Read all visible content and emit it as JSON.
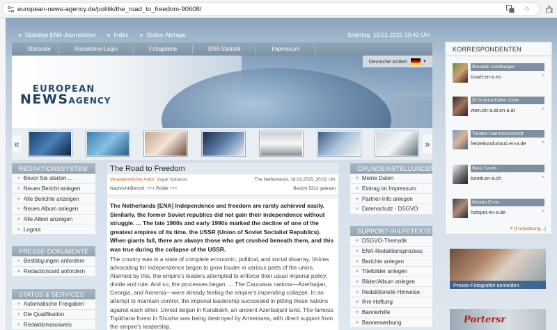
{
  "browser": {
    "url": "european-news-agency.de/politik/the_road_to_freedom-90608/"
  },
  "topbar": {
    "links": [
      "Ständige ENA-Journalisten",
      "Index",
      "Status-Abfrage"
    ],
    "date": "Sonntag, 19.01.2025 10:42 Uhr"
  },
  "mainnav": {
    "items": [
      "Startseite",
      "Redaktions-Login",
      "Fotogalerie",
      "ENA Statistik",
      "Impressum"
    ]
  },
  "banner": {
    "logo_line1": "EUROPEAN",
    "logo_line2a": "NEWS",
    "logo_line2b": "AGENCY",
    "lang_label": "Deutsche Artikel:"
  },
  "redaktionssystem": {
    "title": "REDAKTIONSSYSTEM",
    "items": [
      "Bevor Sie starten ...",
      "Neuen Bericht anlegen",
      "Alle Berichte anzeigen",
      "Neues Album anlegen",
      "Alle Alben anzeigen",
      "Logout"
    ]
  },
  "presse": {
    "title": "PRESSE-DOKUMENTE",
    "items": [
      "Bestätigungen anfordern",
      "Redactioncard anfordern"
    ]
  },
  "status": {
    "title": "STATUS & SERVICES",
    "items": [
      "Automatische Freigaben",
      "Die Qualifikation",
      "Redaktionsausweis"
    ]
  },
  "article": {
    "title": "The Road to Freedom",
    "author_label": "Verantwortlicher Autor:",
    "author": "Vugar Abbasov",
    "location_date": "The Netherlands, 18.01.2025, 20:02 Uhr",
    "category": "Nachricht/Bericht: +++ Politik +++",
    "reads": "Bericht 531x gelesen",
    "lead": "The Netherlands [ENA] Independence and freedom are rarely achieved easily. Similarly, the former Soviet republics did not gain their independence without struggle. ... The late 1980s and early 1990s marked the decline of one of the greatest empires of its time, the USSR (Union of Soviet Socialist Republics). When giants fall, there are always those who get crushed beneath them, and this was true during the collapse of the USSR.",
    "body": "The country was in a state of complete economic, political, and social disarray. Voices advocating for independence began to grow louder in various parts of the union. Alarmed by this, the empire's leaders attempted to enforce their usual imperial policy: divide and rule. And so, the processes began. ... The Caucasus nations—Azerbaijan, Georgia, and Armenia—were already feeling the empire's impending collapse. In an attempt to maintain control, the imperial leadership succeeded in pitting these nations against each other. Unrest began in Karabakh, an ancient Azerbaijani land. The famous Topkhana forest in Shusha was being destroyed by Armenians, with direct support from the empire's leadership."
  },
  "grundeinstellungen": {
    "title": "GRUNDEINSTELLUNGEN",
    "items": [
      "Meine Daten",
      "Eintrag im Impressum",
      "Partner-Info anlegen",
      "Datenschutz - DSGVO"
    ]
  },
  "support": {
    "title": "SUPPORT-/HILFETEXTE",
    "items": [
      "DSGVO-Thematik",
      "ENA-Redaktionsprozess",
      "Berichte anlegen",
      "Titelbilder anlegen",
      "Bilder/Album anlegen",
      "Redaktionelle Hinweise",
      "Ihre Haftung",
      "Bannerhilfe",
      "Bannerwerbung"
    ]
  },
  "korrespondenten": {
    "title": "KORRESPONDENTEN",
    "entries": [
      {
        "name": "Ronaldo Goldberger",
        "site": "Israel.en-a.eu"
      },
      {
        "name": "Dr.Schura Euller Cook",
        "site": "wien.en-a.at.en-a.at"
      },
      {
        "name": "Torsten Hammerschmidt",
        "site": "freizeitundurlaub.en-a.de"
      },
      {
        "name": "Reto Turotti",
        "site": "turotti.en-a.ch"
      },
      {
        "name": "Kirsten Ernst",
        "site": "hotspot.en-a.de"
      }
    ],
    "more": "[Fortsetzung...]"
  },
  "ads": {
    "pressefotografen": "Presse-Fotografen anmelden",
    "fr_text": "Portersr"
  },
  "colors": {
    "nav": "#869cb0",
    "panel_head": "#9fb0be",
    "accent_orange": "#c0621e",
    "logo_blue": "#1f3f66"
  }
}
